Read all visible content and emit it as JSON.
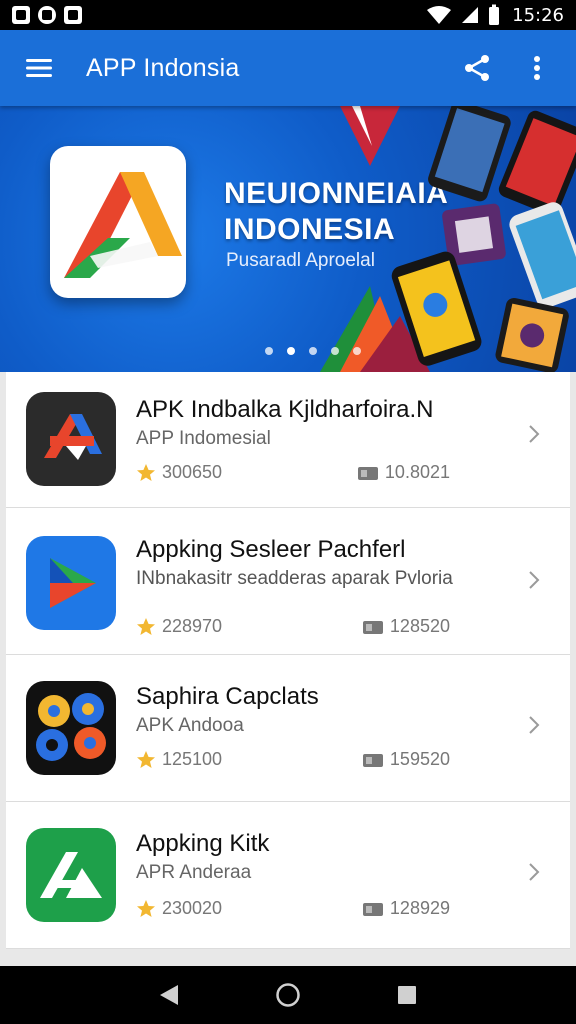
{
  "status_bar": {
    "time": "15:26"
  },
  "app_bar": {
    "title": "APP Indonsia"
  },
  "banner": {
    "title_line1": "NEUIONNEIAIA",
    "title_line2": "INDONESIA",
    "subtitle": "Pusaradl Aproelal",
    "dots": 5,
    "active_dot": 1
  },
  "apps": [
    {
      "name": "APK Indbalka Kjldharfoira.N",
      "desc": "APP Indomesial",
      "rating": "300650",
      "downloads": "10.8021",
      "icon": "apk-logo-icon"
    },
    {
      "name": "Appking Sesleer Pachferl",
      "desc": "INbnakasitr seadderas aparak Pvloria",
      "rating": "228970",
      "downloads": "128520",
      "icon": "play-arrow-icon"
    },
    {
      "name": "Saphira Capclats",
      "desc": "APK Andooa",
      "rating": "125100",
      "downloads": "159520",
      "icon": "circles-logo-icon"
    },
    {
      "name": "Appking Kitk",
      "desc": "APR Anderaa",
      "rating": "230020",
      "downloads": "128929",
      "icon": "green-a-icon"
    }
  ],
  "colors": {
    "primary": "#1b6fd8",
    "star": "#f2b731"
  }
}
